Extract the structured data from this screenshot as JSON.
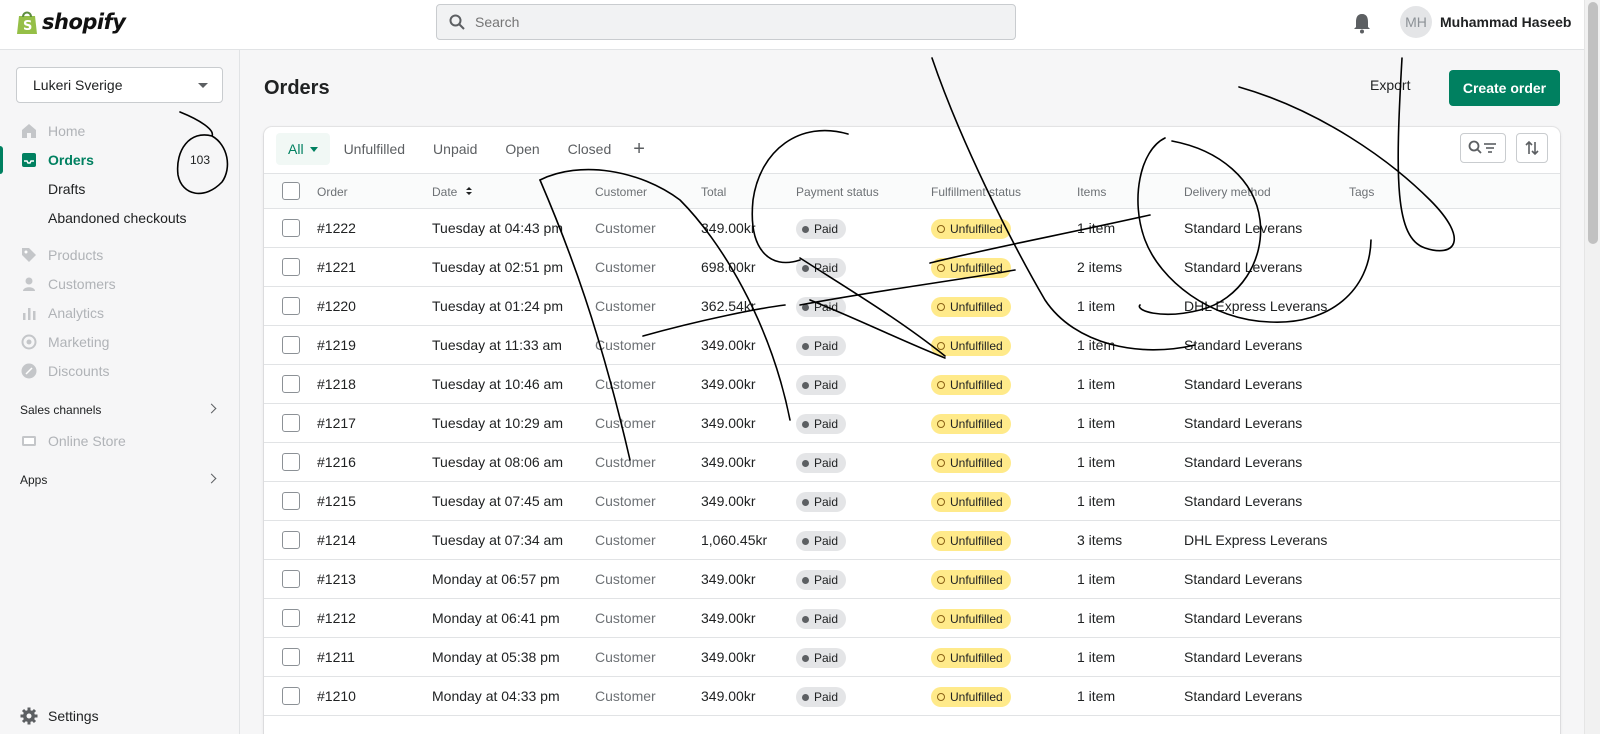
{
  "brand": {
    "name": "shopify"
  },
  "search": {
    "placeholder": "Search"
  },
  "user": {
    "initials": "MH",
    "name": "Muhammad Haseeb"
  },
  "sidebar": {
    "store": "Lukeri Sverige",
    "items": [
      {
        "label": "Home"
      },
      {
        "label": "Orders",
        "count": "103"
      },
      {
        "label": "Drafts"
      },
      {
        "label": "Abandoned checkouts"
      },
      {
        "label": "Products"
      },
      {
        "label": "Customers"
      },
      {
        "label": "Analytics"
      },
      {
        "label": "Marketing"
      },
      {
        "label": "Discounts"
      }
    ],
    "sales_channels_label": "Sales channels",
    "online_store": "Online Store",
    "apps_label": "Apps",
    "settings": "Settings"
  },
  "page": {
    "title": "Orders",
    "export_label": "Export",
    "create_label": "Create order"
  },
  "tabs": [
    "All",
    "Unfulfilled",
    "Unpaid",
    "Open",
    "Closed"
  ],
  "table": {
    "headers": [
      "Order",
      "Date",
      "Customer",
      "Total",
      "Payment status",
      "Fulfillment status",
      "Items",
      "Delivery method",
      "Tags"
    ],
    "rows": [
      {
        "order": "#1222",
        "date": "Tuesday at 04:43 pm",
        "customer": "Customer",
        "total": "349.00kr",
        "payment": "Paid",
        "fulfillment": "Unfulfilled",
        "items": "1 item",
        "delivery": "Standard Leverans"
      },
      {
        "order": "#1221",
        "date": "Tuesday at 02:51 pm",
        "customer": "Customer",
        "total": "698.00kr",
        "payment": "Paid",
        "fulfillment": "Unfulfilled",
        "items": "2 items",
        "delivery": "Standard Leverans"
      },
      {
        "order": "#1220",
        "date": "Tuesday at 01:24 pm",
        "customer": "Customer",
        "total": "362.54kr",
        "payment": "Paid",
        "fulfillment": "Unfulfilled",
        "items": "1 item",
        "delivery": "DHL Express Leverans"
      },
      {
        "order": "#1219",
        "date": "Tuesday at 11:33 am",
        "customer": "Customer",
        "total": "349.00kr",
        "payment": "Paid",
        "fulfillment": "Unfulfilled",
        "items": "1 item",
        "delivery": "Standard Leverans"
      },
      {
        "order": "#1218",
        "date": "Tuesday at 10:46 am",
        "customer": "Customer",
        "total": "349.00kr",
        "payment": "Paid",
        "fulfillment": "Unfulfilled",
        "items": "1 item",
        "delivery": "Standard Leverans"
      },
      {
        "order": "#1217",
        "date": "Tuesday at 10:29 am",
        "customer": "Customer",
        "total": "349.00kr",
        "payment": "Paid",
        "fulfillment": "Unfulfilled",
        "items": "1 item",
        "delivery": "Standard Leverans"
      },
      {
        "order": "#1216",
        "date": "Tuesday at 08:06 am",
        "customer": "Customer",
        "total": "349.00kr",
        "payment": "Paid",
        "fulfillment": "Unfulfilled",
        "items": "1 item",
        "delivery": "Standard Leverans"
      },
      {
        "order": "#1215",
        "date": "Tuesday at 07:45 am",
        "customer": "Customer",
        "total": "349.00kr",
        "payment": "Paid",
        "fulfillment": "Unfulfilled",
        "items": "1 item",
        "delivery": "Standard Leverans"
      },
      {
        "order": "#1214",
        "date": "Tuesday at 07:34 am",
        "customer": "Customer",
        "total": "1,060.45kr",
        "payment": "Paid",
        "fulfillment": "Unfulfilled",
        "items": "3 items",
        "delivery": "DHL Express Leverans"
      },
      {
        "order": "#1213",
        "date": "Monday at 06:57 pm",
        "customer": "Customer",
        "total": "349.00kr",
        "payment": "Paid",
        "fulfillment": "Unfulfilled",
        "items": "1 item",
        "delivery": "Standard Leverans"
      },
      {
        "order": "#1212",
        "date": "Monday at 06:41 pm",
        "customer": "Customer",
        "total": "349.00kr",
        "payment": "Paid",
        "fulfillment": "Unfulfilled",
        "items": "1 item",
        "delivery": "Standard Leverans"
      },
      {
        "order": "#1211",
        "date": "Monday at 05:38 pm",
        "customer": "Customer",
        "total": "349.00kr",
        "payment": "Paid",
        "fulfillment": "Unfulfilled",
        "items": "1 item",
        "delivery": "Standard Leverans"
      },
      {
        "order": "#1210",
        "date": "Monday at 04:33 pm",
        "customer": "Customer",
        "total": "349.00kr",
        "payment": "Paid",
        "fulfillment": "Unfulfilled",
        "items": "1 item",
        "delivery": "Standard Leverans"
      }
    ]
  },
  "colors": {
    "accent": "#008060",
    "unfulfilled": "#ffea8a",
    "paid": "#e4e5e7"
  }
}
